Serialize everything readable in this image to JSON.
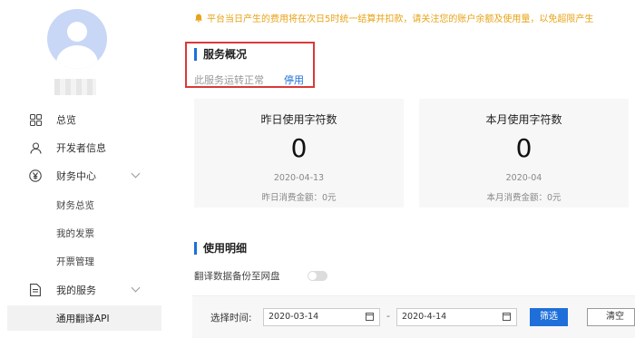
{
  "sidebar": {
    "items": [
      {
        "label": "总览",
        "icon": "grid-icon"
      },
      {
        "label": "开发者信息",
        "icon": "user-icon"
      },
      {
        "label": "财务中心",
        "icon": "yen-icon"
      },
      {
        "label": "财务总览"
      },
      {
        "label": "我的发票"
      },
      {
        "label": "开票管理"
      },
      {
        "label": "我的服务",
        "icon": "document-icon"
      },
      {
        "label": "通用翻译API"
      }
    ]
  },
  "notice": {
    "text": "平台当日产生的费用将在次日5时统一结算并扣款，请关注您的账户余额及使用量，以免超限产生"
  },
  "service": {
    "title": "服务概况",
    "status": "此服务运转正常",
    "disable_label": "停用"
  },
  "cards": [
    {
      "title": "昨日使用字符数",
      "count": "0",
      "date": "2020-04-13",
      "cost": "昨日消费金额：0元"
    },
    {
      "title": "本月使用字符数",
      "count": "0",
      "date": "2020-04",
      "cost": "本月消费金额：0元"
    }
  ],
  "usage": {
    "title": "使用明细",
    "backup_label": "翻译数据备份至网盘",
    "backup_enabled": false,
    "filter_label": "选择时间:",
    "start_date": "2020-03-14",
    "end_date": "2020-4-14",
    "range_separator": "-",
    "search_label": "筛选",
    "clear_label": "清空"
  },
  "colors": {
    "accent": "#1e6fd9",
    "notice": "#e8a317",
    "highlight": "#d83a3a"
  }
}
